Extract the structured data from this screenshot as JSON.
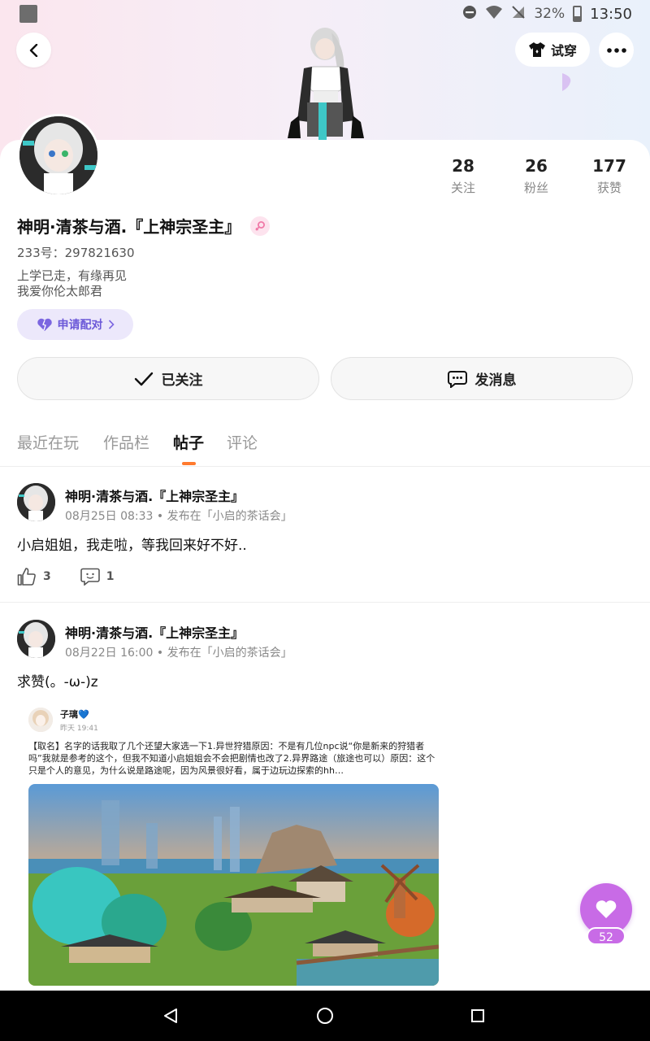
{
  "status_bar": {
    "battery": "32%",
    "time": "13:50"
  },
  "header": {
    "tryon_label": "试穿"
  },
  "profile": {
    "name": "神明·清茶与酒.『上神宗圣主』",
    "uid": "233号：297821630",
    "bio_line1": "上学已走，有缘再见",
    "bio_line2": "我爱你伦太郎君",
    "pair_label": "申请配对",
    "stats": [
      {
        "value": "28",
        "label": "关注"
      },
      {
        "value": "26",
        "label": "粉丝"
      },
      {
        "value": "177",
        "label": "获赞"
      }
    ],
    "follow_label": "已关注",
    "message_label": "发消息"
  },
  "tabs": [
    {
      "label": "最近在玩",
      "active": false
    },
    {
      "label": "作品栏",
      "active": false
    },
    {
      "label": "帖子",
      "active": true
    },
    {
      "label": "评论",
      "active": false
    }
  ],
  "posts": [
    {
      "author": "神明·清茶与酒.『上神宗圣主』",
      "meta": "08月25日 08:33 • 发布在「小启的茶话会」",
      "text": "小启姐姐，我走啦，等我回来好不好..",
      "likes": "3",
      "comments": "1"
    },
    {
      "author": "神明·清茶与酒.『上神宗圣主』",
      "meta": "08月22日 16:00 • 发布在「小启的茶话会」",
      "text": "求赞(。-ω-)z"
    }
  ],
  "embed": {
    "user": "子璃💙",
    "time": "昨天 19:41",
    "text": "【取名】名字的话我取了几个还望大家选一下1.异世狩猎原因：不是有几位npc说“你是新来的狩猎者吗”我就是参考的这个，但我不知道小启姐姐会不会把剧情也改了2.异界路途（旅途也可以）原因：这个只是个人的意见，为什么说是路途呢，因为风景很好看，属于边玩边探索的hh…"
  },
  "fab": {
    "count": "52"
  }
}
